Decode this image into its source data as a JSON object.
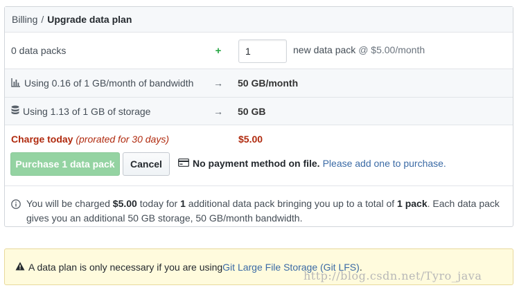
{
  "breadcrumb": {
    "parent": "Billing",
    "separator": "/",
    "current": "Upgrade data plan"
  },
  "packs_row": {
    "current_label": "0 data packs",
    "operator": "+",
    "quantity_value": "1",
    "new_pack_label": "new data pack",
    "price_label": "@ $5.00/month"
  },
  "bandwidth_row": {
    "icon": "bar-chart-icon",
    "label": "Using 0.16 of 1 GB/month of bandwidth",
    "operator": "→",
    "value": "50 GB/month"
  },
  "storage_row": {
    "icon": "database-icon",
    "label": "Using 1.13 of 1 GB of storage",
    "operator": "→",
    "value": "50 GB"
  },
  "charge": {
    "label": "Charge today",
    "note": "(prorated for 30 days)",
    "value": "$5.00"
  },
  "actions": {
    "purchase_label": "Purchase 1 data pack",
    "cancel_label": "Cancel"
  },
  "payment": {
    "icon": "credit-card-icon",
    "message": "No payment method on file.",
    "link": "Please add one to purchase."
  },
  "info": {
    "icon": "info-icon",
    "part1": "You will be charged ",
    "amount": "$5.00",
    "part2": " today for ",
    "count": "1",
    "part3": " additional data pack bringing you up to a total of ",
    "total": "1 pack",
    "part4": ". Each data pack gives you an additional 50 GB storage, 50 GB/month bandwidth."
  },
  "flash": {
    "icon": "alert-icon",
    "text": "A data plan is only necessary if you are using ",
    "link": "Git Large File Storage (Git LFS)",
    "suffix": "."
  },
  "watermark": "http://blog.csdn.net/Tyro_java",
  "colors": {
    "charge_red": "#b02a0e",
    "purchase_green": "#94d3a2",
    "link_blue": "#3a6aa5",
    "flash_yellow": "#fffbdd"
  }
}
